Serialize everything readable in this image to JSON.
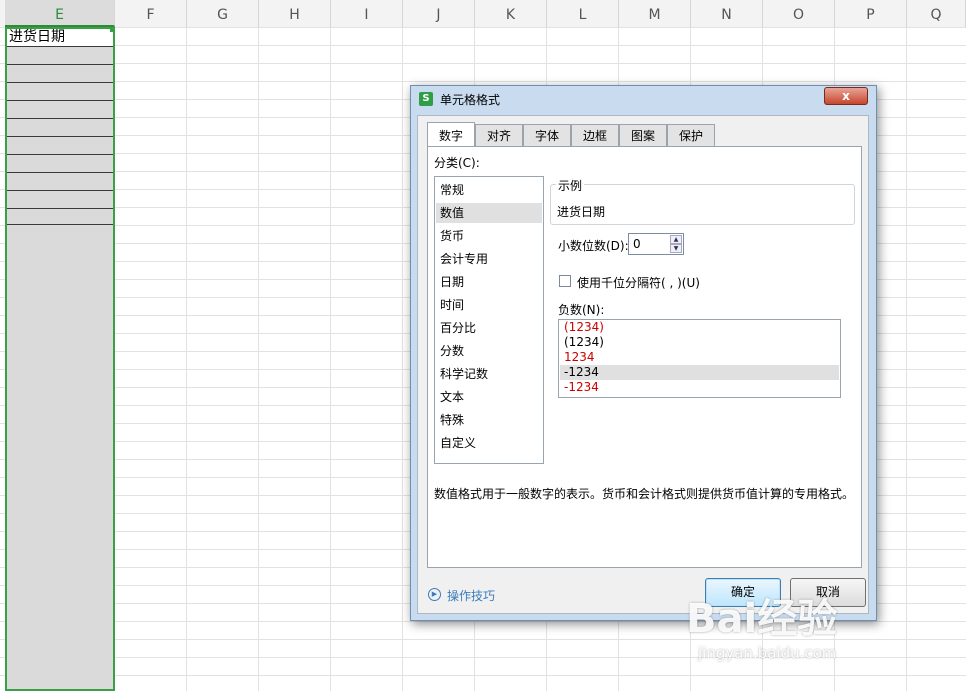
{
  "sheet": {
    "columns": [
      "E",
      "F",
      "G",
      "H",
      "I",
      "J",
      "K",
      "L",
      "M",
      "N",
      "O",
      "P",
      "Q"
    ],
    "active_column": "E",
    "cell_e1": "进货日期"
  },
  "dialog": {
    "title": "单元格格式",
    "close_symbol": "x",
    "app_icon_letter": "S",
    "tabs": [
      {
        "label": "数字",
        "active": true
      },
      {
        "label": "对齐"
      },
      {
        "label": "字体"
      },
      {
        "label": "边框"
      },
      {
        "label": "图案"
      },
      {
        "label": "保护"
      }
    ],
    "category_label": "分类(C):",
    "categories": [
      "常规",
      "数值",
      "货币",
      "会计专用",
      "日期",
      "时间",
      "百分比",
      "分数",
      "科学记数",
      "文本",
      "特殊",
      "自定义"
    ],
    "selected_category": "数值",
    "sample_title": "示例",
    "sample_value": "进货日期",
    "decimal_label": "小数位数(D):",
    "decimal_value": "0",
    "thousands_label": "使用千位分隔符( , )(U)",
    "thousands_checked": false,
    "negative_label": "负数(N):",
    "negative_options": [
      {
        "text": "(1234)",
        "color": "#cc0000"
      },
      {
        "text": "(1234)",
        "color": "#000000"
      },
      {
        "text": "1234",
        "color": "#cc0000"
      },
      {
        "text": "-1234",
        "color": "#000000",
        "selected": true
      },
      {
        "text": "-1234",
        "color": "#cc0000"
      }
    ],
    "description": "数值格式用于一般数字的表示。货币和会计格式则提供货币值计算的专用格式。",
    "tips_label": "操作技巧",
    "ok_label": "确定",
    "cancel_label": "取消"
  },
  "watermark": {
    "logo": "Bai经验",
    "url": "jingyan.baidu.com"
  }
}
